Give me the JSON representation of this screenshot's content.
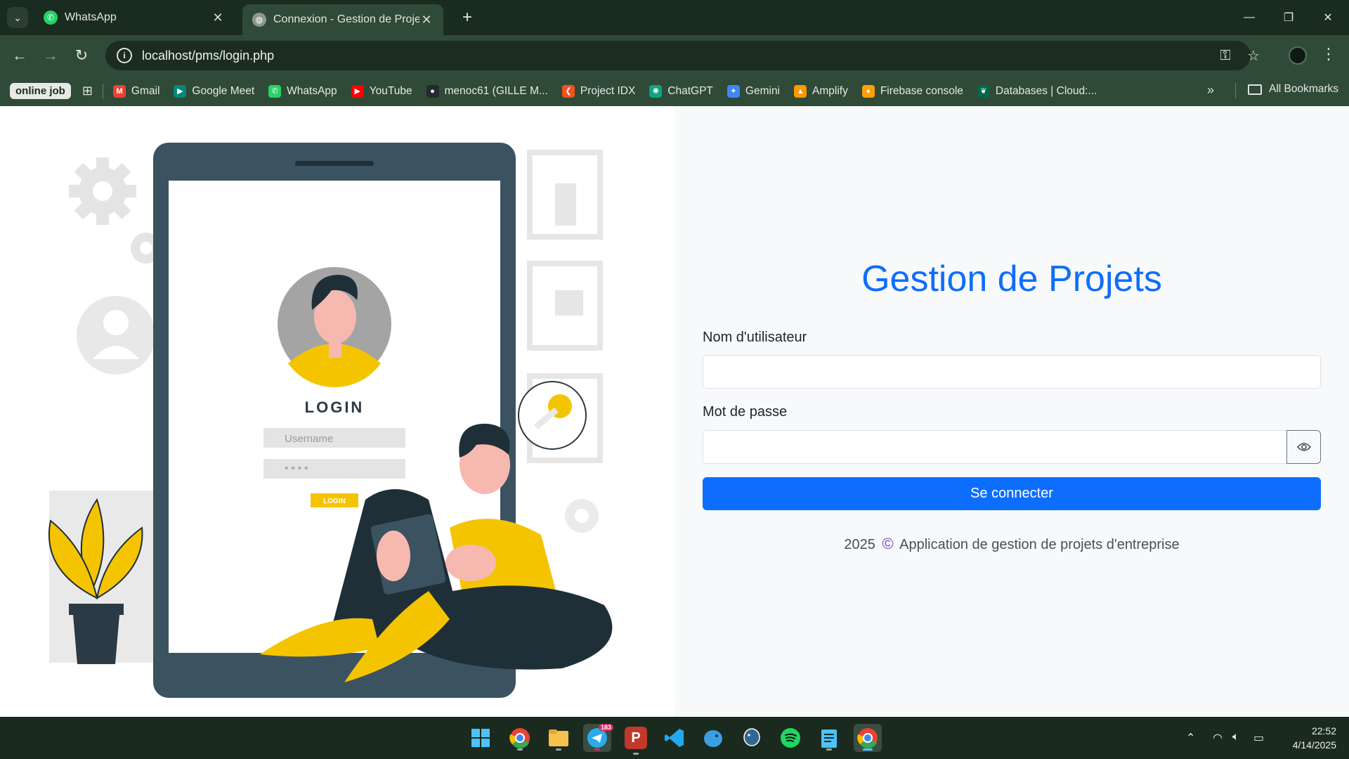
{
  "browser": {
    "tabs": [
      {
        "title": "WhatsApp",
        "active": false
      },
      {
        "title": "Connexion - Gestion de Projets",
        "active": true
      }
    ],
    "url": "localhost/pms/login.php",
    "bookmarks_chip": "online job",
    "bookmarks": [
      {
        "label": "Gmail",
        "icon": "gmail-icon",
        "color": "#ea4335",
        "glyph": "M"
      },
      {
        "label": "Google Meet",
        "icon": "google-meet-icon",
        "color": "#00897b",
        "glyph": "▶"
      },
      {
        "label": "WhatsApp",
        "icon": "whatsapp-icon",
        "color": "#25d366",
        "glyph": "✆"
      },
      {
        "label": "YouTube",
        "icon": "youtube-icon",
        "color": "#ff0000",
        "glyph": "▶"
      },
      {
        "label": "menoc61 (GILLE M...",
        "icon": "github-icon",
        "color": "#24292f",
        "glyph": "●"
      },
      {
        "label": "Project IDX",
        "icon": "project-idx-icon",
        "color": "#f4511e",
        "glyph": "❮"
      },
      {
        "label": "ChatGPT",
        "icon": "chatgpt-icon",
        "color": "#10a37f",
        "glyph": "✺"
      },
      {
        "label": "Gemini",
        "icon": "gemini-icon",
        "color": "#4285f4",
        "glyph": "✦"
      },
      {
        "label": "Amplify",
        "icon": "amplify-icon",
        "color": "#ff9900",
        "glyph": "▲"
      },
      {
        "label": "Firebase console",
        "icon": "firebase-icon",
        "color": "#ffa000",
        "glyph": "♦"
      },
      {
        "label": "Databases | Cloud:...",
        "icon": "mongodb-icon",
        "color": "#00684a",
        "glyph": "❦"
      }
    ],
    "all_bookmarks": "All Bookmarks"
  },
  "login": {
    "app_title": "Gestion de Projets",
    "username_label": "Nom d'utilisateur",
    "username_value": "",
    "password_label": "Mot de passe",
    "password_value": "",
    "submit_label": "Se connecter",
    "footer_year": "2025",
    "footer_symbol": "©",
    "footer_text": "Application de gestion de projets d'entreprise"
  },
  "illustration": {
    "heading": "LOGIN",
    "username_placeholder": "Username",
    "password_mask": "* * * *",
    "button_label": "LOGIN"
  },
  "taskbar": {
    "telegram_badge": "183",
    "time": "22:52",
    "date": "4/14/2025"
  },
  "colors": {
    "primary": "#0d6efd",
    "accent_yellow": "#f5c400",
    "chrome_green": "#2f4a37"
  }
}
